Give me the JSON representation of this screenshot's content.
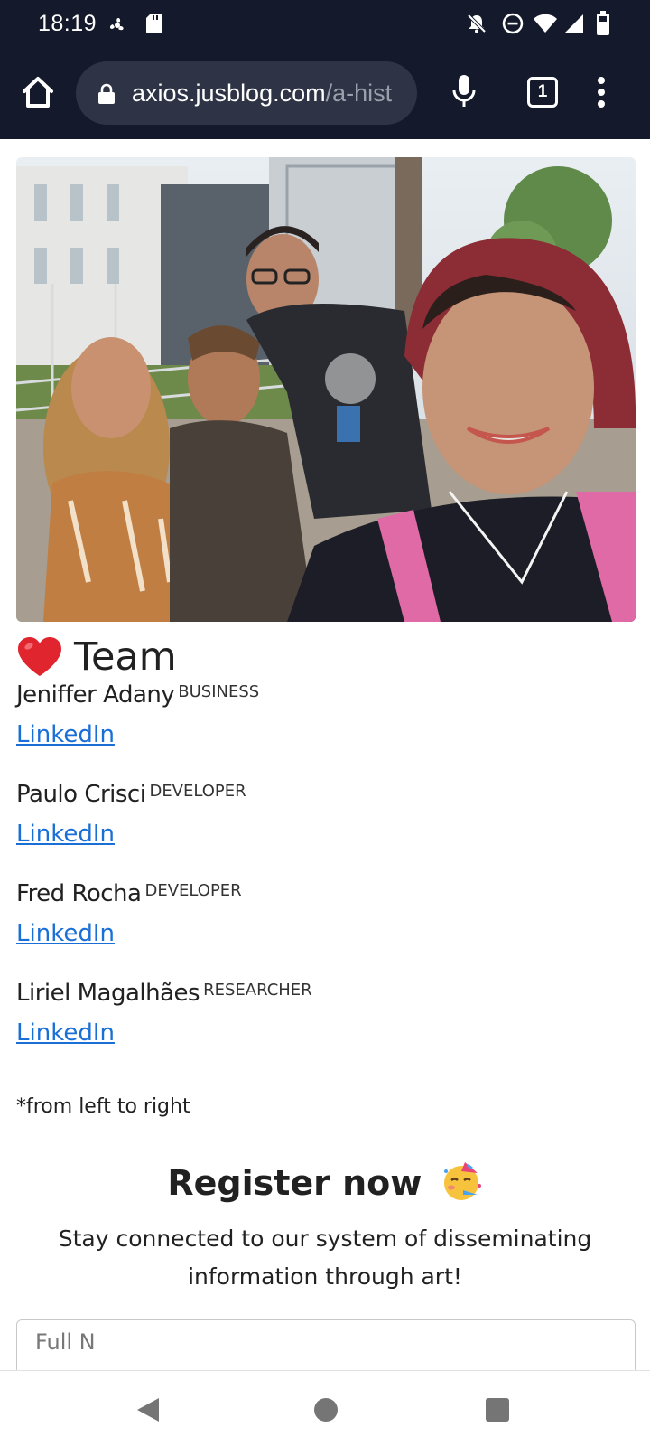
{
  "status_bar": {
    "time": "18:19",
    "left_icons": [
      "fan-icon",
      "sd-card-icon"
    ],
    "right_icons": [
      "notifications-off-icon",
      "do-not-disturb-icon",
      "wifi-icon",
      "signal-icon",
      "battery-icon"
    ]
  },
  "browser": {
    "url_domain": "axios.jusblog.com",
    "url_path": "/a-hist",
    "tab_count": "1",
    "icons": [
      "home-icon",
      "lock-icon",
      "mic-icon",
      "tabs-icon",
      "more-vert-icon"
    ]
  },
  "page": {
    "photo_alt": "team-group-selfie",
    "team_heading": "Team",
    "team_icon": "heart-icon",
    "members": [
      {
        "name": "Jeniffer Adany",
        "role": "BUSINESS",
        "link": "LinkedIn"
      },
      {
        "name": "Paulo Crisci",
        "role": "DEVELOPER",
        "link": "LinkedIn"
      },
      {
        "name": "Fred Rocha",
        "role": "DEVELOPER",
        "link": "LinkedIn"
      },
      {
        "name": "Liriel Magalhães",
        "role": "RESEARCHER",
        "link": "LinkedIn"
      }
    ],
    "footnote": "*from left to right",
    "register_title": "Register now",
    "register_icon": "partying-face-icon",
    "register_subtitle": "Stay connected to our system of disseminating information through art!",
    "name_field_placeholder": "Full N"
  },
  "nav_bar": {
    "icons": [
      "back-icon",
      "home-circle-icon",
      "recents-icon"
    ]
  },
  "colors": {
    "status_bar_bg": "#141a2b",
    "url_bar_bg": "#2e3445",
    "link_blue": "#1a6fd6",
    "heart_red": "#e0252f"
  }
}
